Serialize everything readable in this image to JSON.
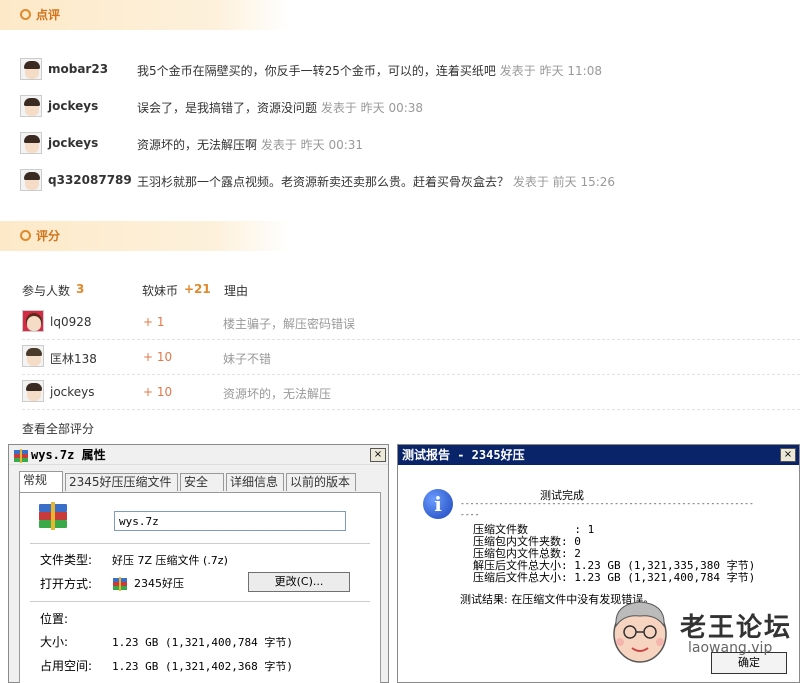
{
  "comments_section": {
    "title": "点评"
  },
  "comments": [
    {
      "user": "mobar23",
      "text": "我5个金币在隔壁买的，你反手一转25个金币，可以的，连着买纸吧",
      "meta": "发表于 昨天 11:08"
    },
    {
      "user": "jockeys",
      "text": "误会了，是我搞错了，资源没问题",
      "meta": "发表于 昨天 00:38"
    },
    {
      "user": "jockeys",
      "text": "资源坏的，无法解压啊",
      "meta": "发表于 昨天 00:31"
    },
    {
      "user": "q332087789",
      "text": "王羽杉就那一个露点视频。老资源新卖还卖那么贵。赶着买骨灰盒去？",
      "meta": "发表于 前天 15:26"
    }
  ],
  "rating_section": {
    "title": "评分",
    "participants_label": "参与人数",
    "participants_count": "3",
    "coin_label": "软妹币",
    "coin_total": "+21",
    "reason_label": "理由",
    "view_all": "查看全部评分"
  },
  "ratings": [
    {
      "user": "lq0928",
      "score": "+ 1",
      "reason": "楼主骗子，解压密码错误"
    },
    {
      "user": "匡林138",
      "score": "+ 10",
      "reason": "妹子不错"
    },
    {
      "user": "jockeys",
      "score": "+ 10",
      "reason": "资源坏的，无法解压"
    }
  ],
  "properties_window": {
    "title": "wys.7z 属性",
    "close": "×",
    "tabs": [
      "常规",
      "2345好压压缩文件",
      "安全",
      "详细信息",
      "以前的版本"
    ],
    "filename": "wys.7z",
    "file_type_label": "文件类型:",
    "file_type_value": "好压 7Z 压缩文件 (.7z)",
    "open_with_label": "打开方式:",
    "open_with_value": "2345好压",
    "change_button": "更改(C)...",
    "location_label": "位置:",
    "size_label": "大小:",
    "size_value": "1.23 GB (1,321,400,784 字节)",
    "size_on_disk_label": "占用空间:",
    "size_on_disk_value": "1.23 GB (1,321,402,368 字节)"
  },
  "report_window": {
    "title": "测试报告 - 2345好压",
    "close": "×",
    "heading": "测试完成",
    "rule": "-------------------------------------------------------------",
    "rule2": "----",
    "lines": [
      "压缩文件数       : 1",
      "压缩包内文件夹数: 0",
      "压缩包内文件总数: 2",
      "解压后文件总大小: 1.23 GB (1,321,335,380 字节)",
      "压缩后文件总大小: 1.23 GB (1,321,400,784 字节)"
    ],
    "result": "测试结果: 在压缩文件中没有发现错误。",
    "ok_button": "确定"
  },
  "watermark": {
    "title": "老王论坛",
    "subtitle": "laowang.vip"
  },
  "colors": {
    "accent": "#e08a2c",
    "report_titlebar": "#0a246a"
  }
}
